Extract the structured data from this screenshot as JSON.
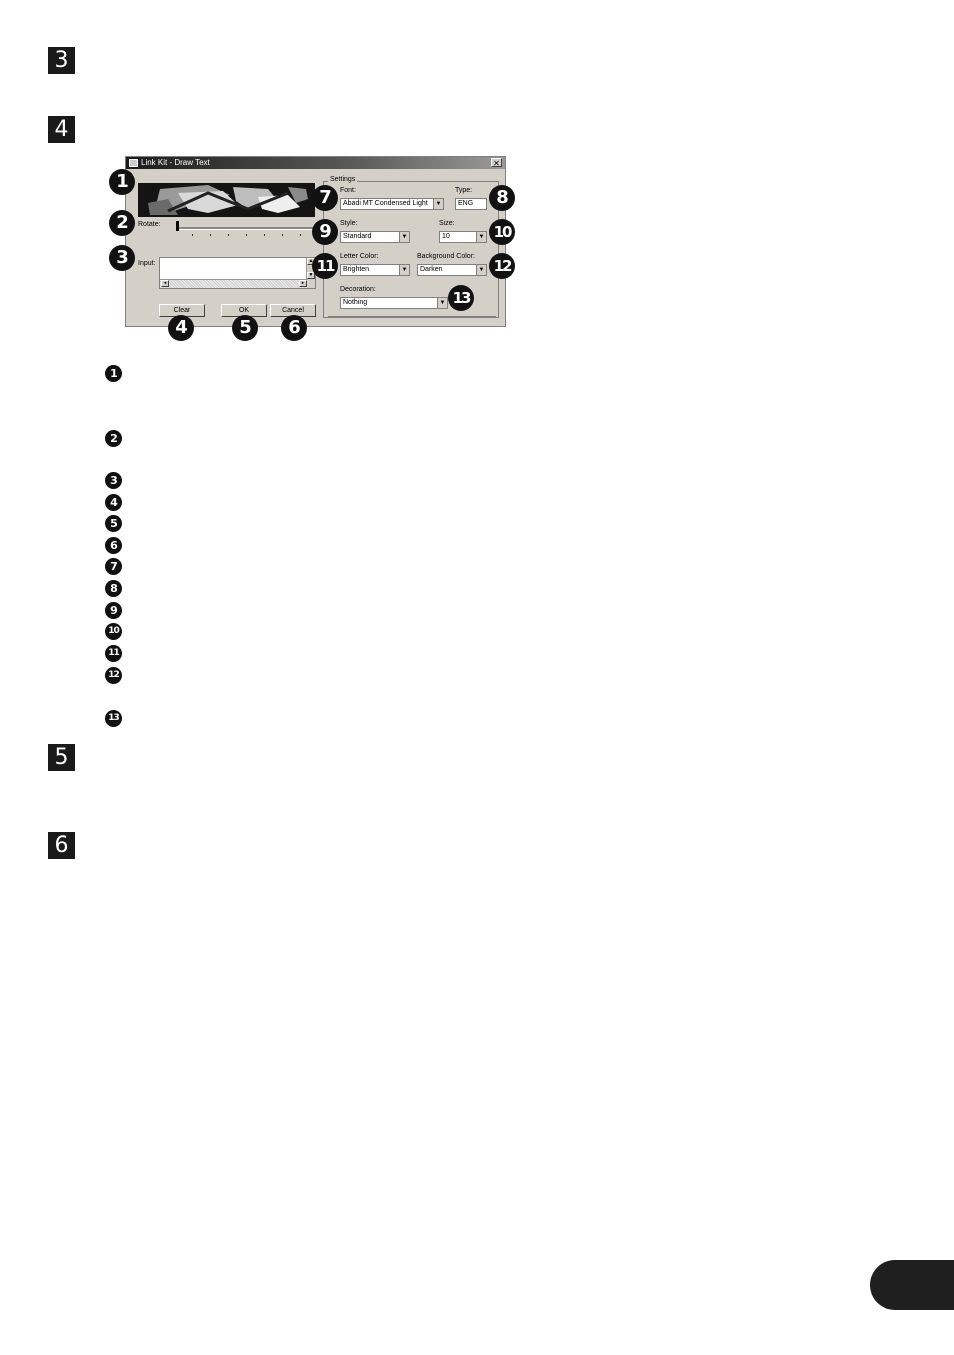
{
  "steps": [
    "3",
    "4",
    "5",
    "6"
  ],
  "dialog": {
    "title": "Link Kit - Draw Text",
    "close_glyph": "✕",
    "rotate_label": "Rotate:",
    "input_label": "Input:",
    "scroll_up": "▲",
    "scroll_down": "▼",
    "scroll_left": "◂",
    "scroll_right": "▸",
    "buttons": {
      "clear": "Clear",
      "ok": "OK",
      "cancel": "Cancel"
    },
    "settings": {
      "group_title": "Settings",
      "font_label": "Font:",
      "font_value": "Abadi MT Condensed Light",
      "type_label": "Type:",
      "type_value": "ENG",
      "style_label": "Style:",
      "style_value": "Standard",
      "size_label": "Size:",
      "size_value": "10",
      "letter_color_label": "Letter Color:",
      "letter_color_value": "Brighten",
      "background_color_label": "Background Color:",
      "background_color_value": "Darken",
      "decoration_label": "Decoration:",
      "decoration_value": "Nothing"
    },
    "dropdown_glyph": "▼"
  },
  "callouts": [
    "1",
    "2",
    "3",
    "4",
    "5",
    "6",
    "7",
    "8",
    "9",
    "10",
    "11",
    "12",
    "13"
  ],
  "icons": [
    "app-icon",
    "close-icon",
    "dropdown-arrow-icon",
    "scroll-arrow-icon"
  ]
}
